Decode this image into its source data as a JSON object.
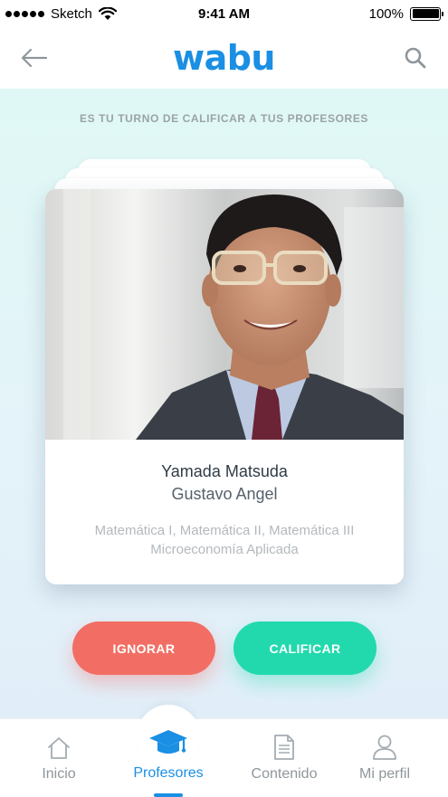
{
  "status_bar": {
    "carrier": "Sketch",
    "time": "9:41 AM",
    "battery": "100%"
  },
  "nav": {
    "logo": "wabu",
    "back_icon": "arrow-left-icon",
    "search_icon": "search-icon"
  },
  "prompt": "ES TU TURNO DE CALIFICAR A TUS PROFESORES",
  "profile": {
    "last_name": "Yamada Matsuda",
    "first_name": "Gustavo Angel",
    "subjects_line1": "Matemática I, Matemática II, Matemática III",
    "subjects_line2": "Microeconomía Aplicada"
  },
  "actions": {
    "ignore": "IGNORAR",
    "rate": "CALIFICAR"
  },
  "tabs": [
    {
      "label": "Inicio",
      "icon": "home-icon",
      "active": false
    },
    {
      "label": "Profesores",
      "icon": "graduation-cap-icon",
      "active": true
    },
    {
      "label": "Contenido",
      "icon": "document-icon",
      "active": false
    },
    {
      "label": "Mi perfil",
      "icon": "user-icon",
      "active": false
    }
  ],
  "colors": {
    "brand": "#1a8fe3",
    "ignore": "#f26e64",
    "rate": "#22d9ad"
  }
}
